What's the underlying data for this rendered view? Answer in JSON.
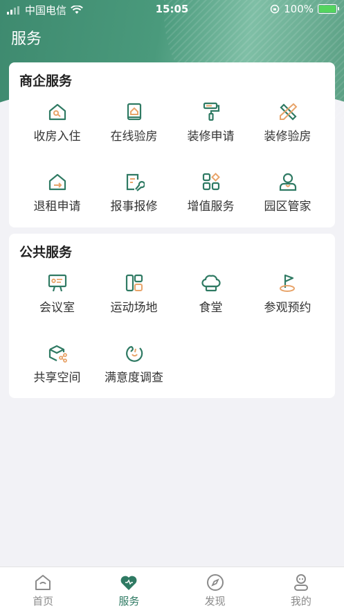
{
  "status_bar": {
    "carrier": "中国电信",
    "time": "15:05",
    "battery": "100%"
  },
  "header": {
    "title": "服务"
  },
  "colors": {
    "accent": "#2f7a63",
    "secondary": "#e8a46a"
  },
  "business": {
    "title": "商企服务",
    "items": [
      {
        "label": "收房入住",
        "icon": "house-key-icon"
      },
      {
        "label": "在线验房",
        "icon": "inspection-book-icon"
      },
      {
        "label": "装修申请",
        "icon": "paint-roller-icon"
      },
      {
        "label": "装修验房",
        "icon": "ruler-pencil-icon"
      },
      {
        "label": "退租申请",
        "icon": "house-exit-icon"
      },
      {
        "label": "报事报修",
        "icon": "repair-wrench-icon"
      },
      {
        "label": "增值服务",
        "icon": "apps-grid-icon"
      },
      {
        "label": "园区管家",
        "icon": "butler-icon"
      }
    ]
  },
  "public": {
    "title": "公共服务",
    "items": [
      {
        "label": "会议室",
        "icon": "presentation-board-icon"
      },
      {
        "label": "运动场地",
        "icon": "sports-field-icon"
      },
      {
        "label": "食堂",
        "icon": "chef-hat-icon"
      },
      {
        "label": "参观预约",
        "icon": "flag-icon"
      },
      {
        "label": "共享空间",
        "icon": "shared-box-icon"
      },
      {
        "label": "满意度调查",
        "icon": "smile-survey-icon"
      }
    ]
  },
  "tabbar": [
    {
      "label": "首页",
      "icon": "home-icon"
    },
    {
      "label": "服务",
      "icon": "heart-icon",
      "active": true
    },
    {
      "label": "发现",
      "icon": "compass-icon"
    },
    {
      "label": "我的",
      "icon": "profile-icon"
    }
  ]
}
